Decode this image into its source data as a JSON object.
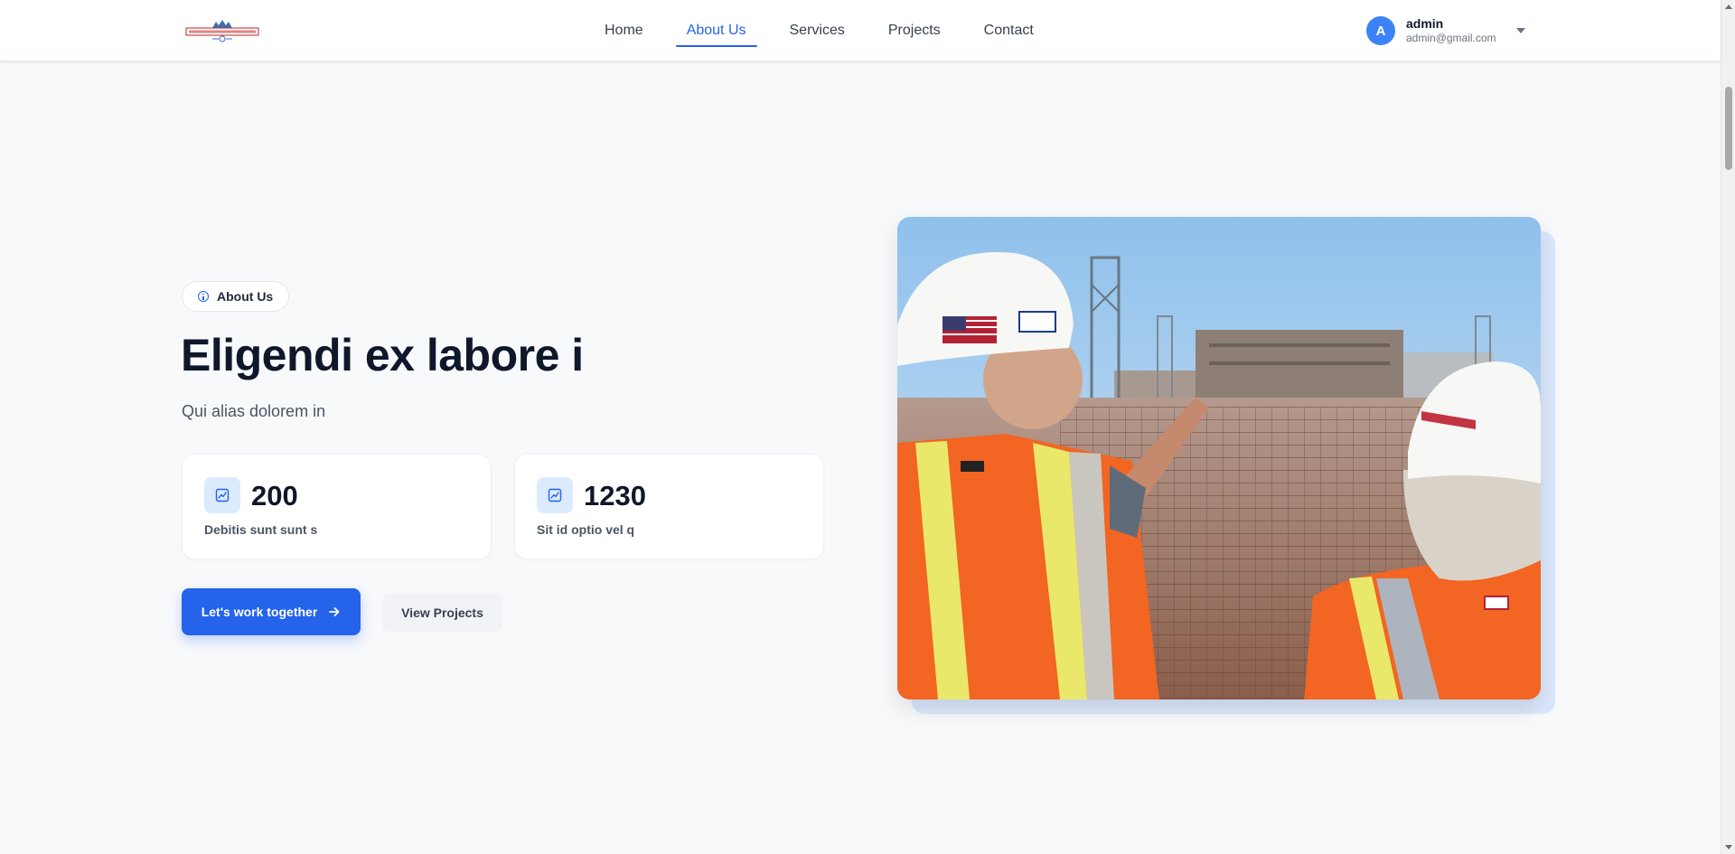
{
  "header": {
    "nav": [
      {
        "label": "Home",
        "active": false
      },
      {
        "label": "About Us",
        "active": true
      },
      {
        "label": "Services",
        "active": false
      },
      {
        "label": "Projects",
        "active": false
      },
      {
        "label": "Contact",
        "active": false
      }
    ],
    "user": {
      "initial": "A",
      "name": "admin",
      "email": "admin@gmail.com"
    }
  },
  "hero": {
    "badge": "About Us",
    "title": "Eligendi ex labore i",
    "subtitle": "Qui alias dolorem in",
    "stats": [
      {
        "value": "200",
        "label": "Debitis sunt sunt s",
        "icon": "chart-line-icon"
      },
      {
        "value": "1230",
        "label": "Sit id optio vel q",
        "icon": "chart-line-icon"
      }
    ],
    "primary_button": "Let's work together",
    "secondary_button": "View Projects"
  },
  "colors": {
    "accent": "#2563eb",
    "background": "#f8f9fb",
    "avatar": "#3b82f6",
    "icon_bg": "#dbeafe"
  }
}
